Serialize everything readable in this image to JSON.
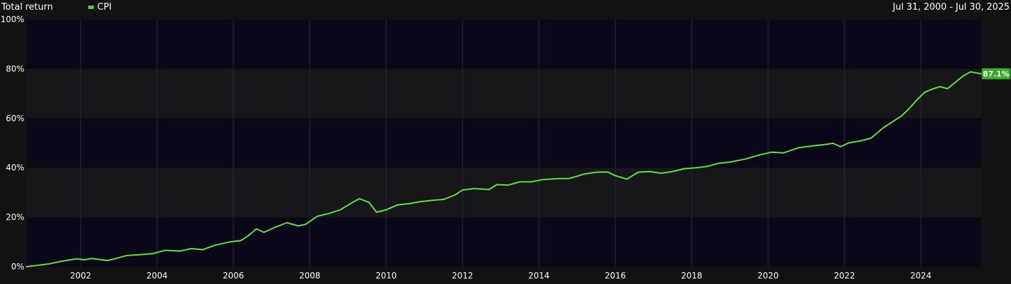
{
  "header": {
    "title": "Total return",
    "date_range": "Jul 31, 2000 - Jul 30, 2025"
  },
  "colors": {
    "background": "#121212",
    "band_dark": "#0a0818",
    "band_light": "#171619",
    "line": "#5fe23f",
    "end_badge": "#3aa82c"
  },
  "chart_data": {
    "type": "line",
    "xlabel": "",
    "ylabel": "",
    "x_ticks": [
      "2002",
      "2004",
      "2006",
      "2008",
      "2010",
      "2012",
      "2014",
      "2016",
      "2018",
      "2020",
      "2022",
      "2024"
    ],
    "y_ticks": [
      "0%",
      "20%",
      "40%",
      "60%",
      "80%",
      "100%"
    ],
    "ylim": [
      0,
      100
    ],
    "xlim": [
      2000.58,
      2025.58
    ],
    "grid": true,
    "legend_position": "top-left",
    "series": [
      {
        "name": "CPI",
        "end_label": "87.1%",
        "points": [
          [
            2000.58,
            0.0
          ],
          [
            2000.9,
            0.6
          ],
          [
            2001.2,
            1.2
          ],
          [
            2001.5,
            2.2
          ],
          [
            2001.9,
            3.2
          ],
          [
            2002.1,
            2.8
          ],
          [
            2002.3,
            3.3
          ],
          [
            2002.7,
            2.5
          ],
          [
            2002.9,
            3.2
          ],
          [
            2003.2,
            4.5
          ],
          [
            2003.6,
            4.9
          ],
          [
            2003.9,
            5.3
          ],
          [
            2004.2,
            6.6
          ],
          [
            2004.6,
            6.3
          ],
          [
            2004.9,
            7.3
          ],
          [
            2005.2,
            6.9
          ],
          [
            2005.5,
            8.6
          ],
          [
            2005.9,
            10.0
          ],
          [
            2006.2,
            10.6
          ],
          [
            2006.4,
            12.6
          ],
          [
            2006.6,
            15.3
          ],
          [
            2006.8,
            13.9
          ],
          [
            2007.1,
            16.0
          ],
          [
            2007.4,
            17.8
          ],
          [
            2007.7,
            16.5
          ],
          [
            2007.9,
            17.2
          ],
          [
            2008.2,
            20.4
          ],
          [
            2008.5,
            21.5
          ],
          [
            2008.8,
            23.0
          ],
          [
            2009.1,
            25.8
          ],
          [
            2009.3,
            27.5
          ],
          [
            2009.55,
            26.0
          ],
          [
            2009.75,
            22.0
          ],
          [
            2010.0,
            23.0
          ],
          [
            2010.3,
            25.0
          ],
          [
            2010.6,
            25.5
          ],
          [
            2010.9,
            26.3
          ],
          [
            2011.2,
            26.8
          ],
          [
            2011.5,
            27.2
          ],
          [
            2011.8,
            29.0
          ],
          [
            2012.0,
            31.0
          ],
          [
            2012.3,
            31.6
          ],
          [
            2012.7,
            31.2
          ],
          [
            2012.9,
            33.2
          ],
          [
            2013.2,
            33.0
          ],
          [
            2013.5,
            34.3
          ],
          [
            2013.8,
            34.3
          ],
          [
            2014.1,
            35.2
          ],
          [
            2014.5,
            35.6
          ],
          [
            2014.8,
            35.7
          ],
          [
            2015.2,
            37.5
          ],
          [
            2015.5,
            38.2
          ],
          [
            2015.8,
            38.3
          ],
          [
            2016.0,
            36.8
          ],
          [
            2016.3,
            35.4
          ],
          [
            2016.6,
            38.2
          ],
          [
            2016.9,
            38.5
          ],
          [
            2017.2,
            37.8
          ],
          [
            2017.5,
            38.5
          ],
          [
            2017.8,
            39.6
          ],
          [
            2018.1,
            40.0
          ],
          [
            2018.4,
            40.5
          ],
          [
            2018.7,
            41.8
          ],
          [
            2019.0,
            42.3
          ],
          [
            2019.4,
            43.5
          ],
          [
            2019.8,
            45.3
          ],
          [
            2020.1,
            46.3
          ],
          [
            2020.4,
            46.0
          ],
          [
            2020.8,
            48.1
          ],
          [
            2021.2,
            48.9
          ],
          [
            2021.5,
            49.4
          ],
          [
            2021.7,
            49.9
          ],
          [
            2021.9,
            48.5
          ],
          [
            2022.1,
            50.0
          ],
          [
            2022.4,
            50.8
          ],
          [
            2022.7,
            52.0
          ],
          [
            2023.0,
            56.0
          ],
          [
            2023.3,
            59.0
          ],
          [
            2023.5,
            61.0
          ],
          [
            2023.7,
            64.0
          ],
          [
            2023.9,
            67.5
          ],
          [
            2024.1,
            70.5
          ],
          [
            2024.3,
            71.8
          ],
          [
            2024.5,
            72.8
          ],
          [
            2024.7,
            72.0
          ],
          [
            2024.9,
            74.5
          ],
          [
            2025.1,
            77.0
          ],
          [
            2025.3,
            78.8
          ],
          [
            2025.58,
            78.0
          ]
        ]
      }
    ]
  }
}
